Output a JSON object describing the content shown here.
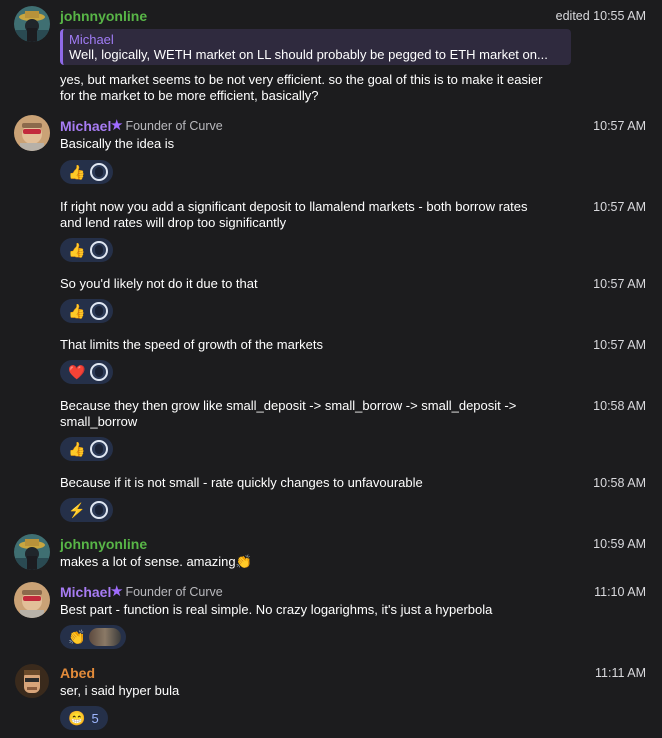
{
  "colors": {
    "background": "#1c1c1e",
    "johnny_name": "#58b547",
    "michael_name": "#a77cf3",
    "abed_name": "#e38b3a",
    "reaction_bg": "#253049"
  },
  "messages": [
    {
      "sender": "johnnyonline",
      "time": "edited 10:55 AM",
      "reply": {
        "name": "Michael",
        "text": "Well, logically, WETH market on LL should probably be pegged to ETH market on..."
      },
      "lines": [
        "yes, but market seems to be not very efficient. so the goal of this is to make it easier",
        "for the market to be more efficient, basically?"
      ]
    },
    {
      "sender": "Michael",
      "badge": "Founder of Curve",
      "time": "10:57 AM",
      "lines": [
        "Basically the idea is"
      ],
      "reaction": "👍"
    },
    {
      "time": "10:57 AM",
      "lines": [
        "If right now you add a significant deposit to llamalend markets - both borrow rates",
        "and lend rates will drop too significantly"
      ],
      "reaction": "👍"
    },
    {
      "time": "10:57 AM",
      "lines": [
        "So you'd likely not do it due to that"
      ],
      "reaction": "👍"
    },
    {
      "time": "10:57 AM",
      "lines": [
        "That limits the speed of growth of the markets"
      ],
      "reaction": "❤️"
    },
    {
      "time": "10:58 AM",
      "lines": [
        "Because they then grow like small_deposit -> small_borrow -> small_deposit ->",
        "small_borrow"
      ],
      "reaction": "👍"
    },
    {
      "time": "10:58 AM",
      "lines": [
        "Because if it is not small - rate quickly changes to unfavourable"
      ],
      "reaction": "⚡"
    },
    {
      "sender": "johnnyonline",
      "time": "10:59 AM",
      "lines": [
        "makes a lot of sense. amazing👏"
      ]
    },
    {
      "sender": "Michael",
      "badge": "Founder of Curve",
      "time": "11:10 AM",
      "lines": [
        "Best part - function is real simple. No crazy logarighms, it's just a hyperbola"
      ],
      "reaction": "👏"
    },
    {
      "sender": "Abed",
      "time": "11:11 AM",
      "lines": [
        "ser, i said hyper bula"
      ],
      "reaction": "😁",
      "reaction_count": "5"
    }
  ]
}
